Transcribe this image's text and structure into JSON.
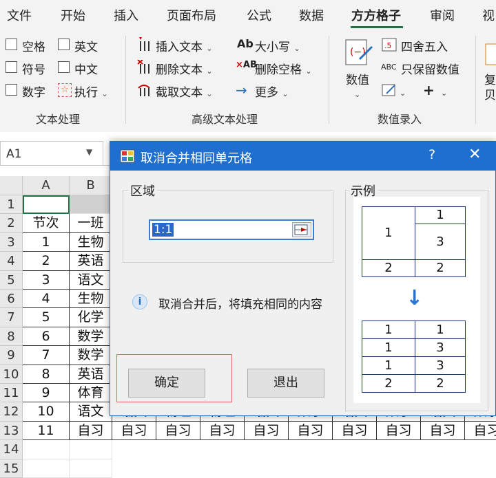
{
  "ribbon": {
    "tabs": [
      "文件",
      "开始",
      "插入",
      "页面布局",
      "公式",
      "数据",
      "方方格子",
      "审阅",
      "视"
    ],
    "active_tab": "方方格子",
    "text_group": {
      "checkboxes": [
        "空格",
        "英文",
        "符号",
        "中文",
        "数字"
      ],
      "exec_label": "执行",
      "label": "文本处理"
    },
    "advanced_group": {
      "items": [
        "插入文本",
        "删除文本",
        "截取文本",
        "大小写",
        "删除空格",
        "更多"
      ],
      "ab_icon": "Ab",
      "label": "高级文本处理"
    },
    "number_group": {
      "value_label": "数值",
      "items": [
        "四舍五入",
        "只保留数值"
      ],
      "abc_icon": "ABC",
      "label": "数值录入"
    },
    "cut_label": "复",
    "cut_label2": "贝"
  },
  "formula_bar": {
    "name_box": "A1"
  },
  "sheet": {
    "columns": [
      "A",
      "B"
    ],
    "rows": [
      "1",
      "2",
      "3",
      "4",
      "5",
      "6",
      "7",
      "8",
      "9",
      "10",
      "11",
      "12",
      "13",
      "14",
      "15"
    ],
    "col_a": [
      "",
      "节次",
      "1",
      "2",
      "3",
      "4",
      "5",
      "6",
      "7",
      "8",
      "9",
      "10",
      "11"
    ],
    "col_b": [
      "",
      "一班",
      "生物",
      "英语",
      "语文",
      "生物",
      "化学",
      "数学",
      "数学",
      "英语",
      "体育",
      "语文",
      "自习"
    ],
    "row13_rest": [
      "自习",
      "自习",
      "自习",
      "自习",
      "自习",
      "自习",
      "自习",
      "自习",
      "自习"
    ],
    "row12_rest": [
      "语文",
      "物理",
      "物理",
      "语文",
      "数学",
      "语文",
      "数学",
      "语文",
      "数学"
    ]
  },
  "dialog": {
    "title": "取消合并相同单元格",
    "help": "?",
    "close": "✕",
    "area_legend": "区域",
    "range_value": "1:1",
    "example_legend": "示例",
    "info_icon": "i",
    "info_text": "取消合并后，将填充相同的内容",
    "ok_label": "确定",
    "exit_label": "退出",
    "example_before": [
      "1",
      "1",
      "3",
      "2",
      "2"
    ],
    "arrow": "↓",
    "example_after": [
      [
        "1",
        "1"
      ],
      [
        "1",
        "3"
      ],
      [
        "1",
        "3"
      ],
      [
        "2",
        "2"
      ]
    ]
  }
}
